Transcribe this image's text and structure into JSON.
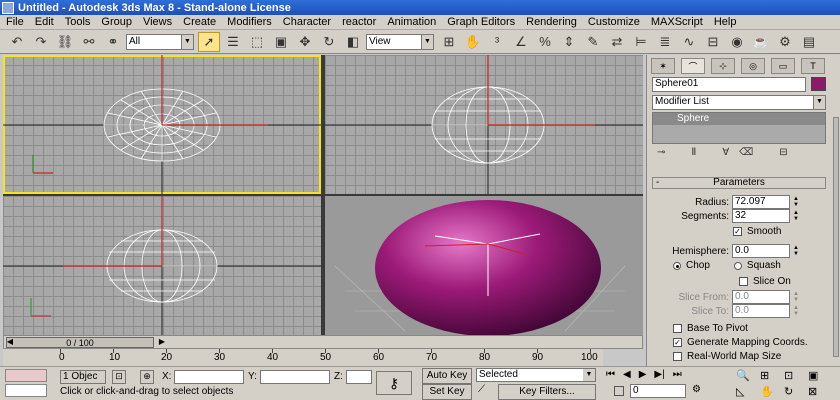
{
  "window": {
    "title": "Untitled - Autodesk 3ds Max 8 - Stand-alone License"
  },
  "menu": [
    "File",
    "Edit",
    "Tools",
    "Group",
    "Views",
    "Create",
    "Modifiers",
    "Character",
    "reactor",
    "Animation",
    "Graph Editors",
    "Rendering",
    "Customize",
    "MAXScript",
    "Help"
  ],
  "toolbar": {
    "selection_filter": "All",
    "ref_coord": "View",
    "icons": [
      "undo-icon",
      "redo-icon",
      "select-link-icon",
      "unlink-icon",
      "bind-space-warp-icon"
    ]
  },
  "command_panel": {
    "object_name": "Sphere01",
    "object_color": "#8b1a6a",
    "modifier_list": "Modifier List",
    "stack_item": "Sphere",
    "rollout_title": "Parameters",
    "radius_label": "Radius:",
    "radius_value": "72.097",
    "segments_label": "Segments:",
    "segments_value": "32",
    "smooth_label": "Smooth",
    "hemisphere_label": "Hemisphere:",
    "hemisphere_value": "0.0",
    "chop_label": "Chop",
    "squash_label": "Squash",
    "slice_on_label": "Slice On",
    "slice_from_label": "Slice From:",
    "slice_from_value": "0.0",
    "slice_to_label": "Slice To:",
    "slice_to_value": "0.0",
    "base_to_pivot_label": "Base To Pivot",
    "gen_mapping_label": "Generate Mapping Coords.",
    "real_world_label": "Real-World Map Size"
  },
  "timeline": {
    "slider_label": "0 / 100",
    "ticks": [
      "0",
      "10",
      "20",
      "30",
      "40",
      "50",
      "60",
      "70",
      "80",
      "90",
      "100"
    ]
  },
  "status": {
    "selection_count": "1 Objec",
    "x_label": "X:",
    "y_label": "Y:",
    "z_label": "Z:",
    "auto_key": "Auto Key",
    "set_key": "Set Key",
    "key_mode": "Selected",
    "key_filters": "Key Filters...",
    "frame_value": "0",
    "prompt": "Click or click-and-drag to select objects"
  },
  "colors": {
    "accent": "#f6e51a",
    "sphere": "#9c1a78"
  }
}
